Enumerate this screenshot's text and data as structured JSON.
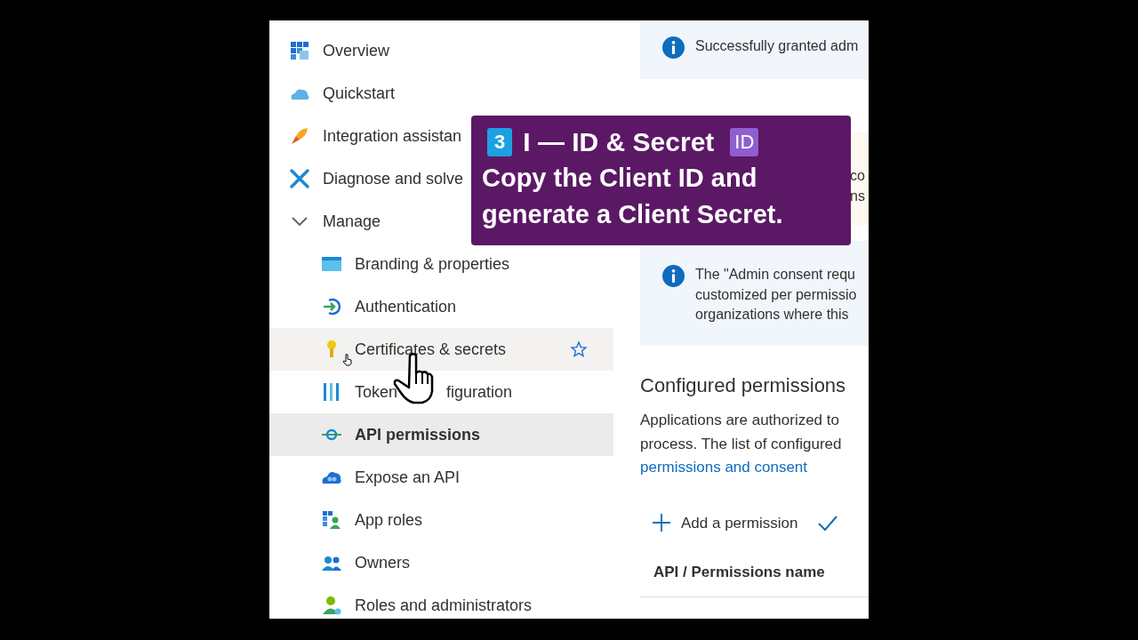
{
  "sidebar": {
    "items": [
      {
        "label": "Overview",
        "kind": "item",
        "selected": false,
        "hovered": false
      },
      {
        "label": "Quickstart",
        "kind": "item",
        "selected": false,
        "hovered": false
      },
      {
        "label": "Integration assistan",
        "kind": "item",
        "selected": false,
        "hovered": false
      },
      {
        "label": "Diagnose and solve",
        "kind": "item",
        "selected": false,
        "hovered": false
      },
      {
        "label": "Manage",
        "kind": "group",
        "expanded": true,
        "children": [
          {
            "label": "Branding & properties",
            "kind": "item",
            "selected": false,
            "hovered": false
          },
          {
            "label": "Authentication",
            "kind": "item",
            "selected": false,
            "hovered": false
          },
          {
            "label": "Certificates & secrets",
            "kind": "item",
            "selected": false,
            "hovered": true
          },
          {
            "label": "Token",
            "kind": "item",
            "selected": false,
            "hovered": false,
            "tail": "figuration"
          },
          {
            "label": "API permissions",
            "kind": "item",
            "selected": true,
            "hovered": false
          },
          {
            "label": "Expose an API",
            "kind": "item",
            "selected": false,
            "hovered": false
          },
          {
            "label": "App roles",
            "kind": "item",
            "selected": false,
            "hovered": false
          },
          {
            "label": "Owners",
            "kind": "item",
            "selected": false,
            "hovered": false
          },
          {
            "label": "Roles and administrators",
            "kind": "item",
            "selected": false,
            "hovered": false
          }
        ]
      }
    ]
  },
  "main": {
    "notices": [
      {
        "kind": "info",
        "lines": [
          "Successfully granted adm"
        ]
      },
      {
        "kind": "warning",
        "lines": [
          "co",
          "ns"
        ]
      },
      {
        "kind": "info",
        "lines": [
          "The \"Admin consent requ",
          "customized per permissio",
          "organizations where this"
        ]
      }
    ],
    "section_title": "Configured permissions",
    "description_lines": [
      "Applications are authorized to",
      "process. The list of configured"
    ],
    "link": "permissions and consent",
    "toolbar": [
      {
        "kind": "add",
        "label": "Add a permission"
      },
      {
        "kind": "check"
      }
    ],
    "table": {
      "columns": [
        "API / Permissions name"
      ]
    }
  },
  "callout": {
    "step": "3",
    "title": "I — ID & Secret",
    "badge": "ID",
    "text": "Copy the Client ID and generate a Client Secret."
  }
}
